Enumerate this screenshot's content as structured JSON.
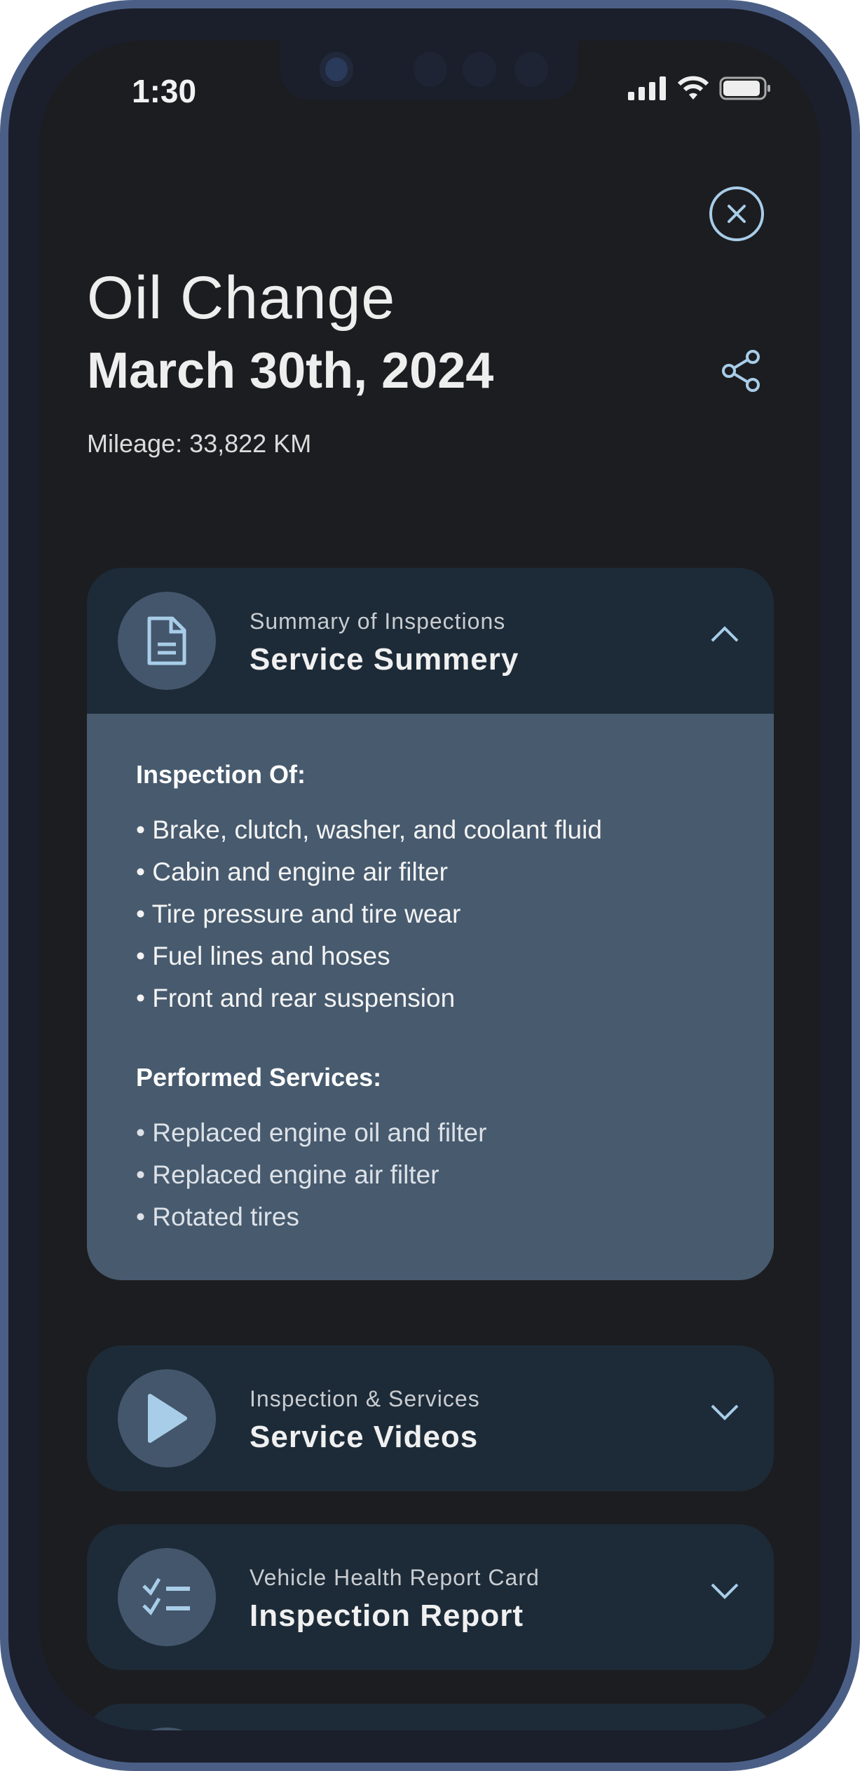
{
  "status_bar": {
    "time": "1:30",
    "signal_icon": "signal-icon",
    "wifi_icon": "wifi-icon",
    "battery_icon": "battery-icon"
  },
  "header": {
    "service_type": "Oil Change",
    "date": "March 30th, 2024",
    "mileage": "Mileage: 33,822 KM",
    "close_icon": "close-circle-icon",
    "share_icon": "share-icon"
  },
  "cards": [
    {
      "subtitle": "Summary of Inspections",
      "title": "Service Summery",
      "icon": "document-icon",
      "expanded": true,
      "sections": [
        {
          "heading": "Inspection Of:",
          "items": [
            "Brake, clutch, washer, and coolant fluid",
            "Cabin and engine air filter",
            "Tire pressure and tire wear",
            "Fuel lines and hoses",
            "Front and rear suspension"
          ]
        },
        {
          "heading": "Performed Services:",
          "items": [
            "Replaced engine oil and filter",
            "Replaced engine air filter",
            "Rotated tires"
          ]
        }
      ]
    },
    {
      "subtitle": "Inspection & Services",
      "title": "Service Videos",
      "icon": "play-icon",
      "expanded": false
    },
    {
      "subtitle": "Vehicle Health Report Card",
      "title": "Inspection Report",
      "icon": "checklist-icon",
      "expanded": false
    }
  ],
  "colors": {
    "accent": "#a8cde9",
    "card": "#1d2b38",
    "card_body": "#475a6e",
    "background": "#1c1d20"
  }
}
